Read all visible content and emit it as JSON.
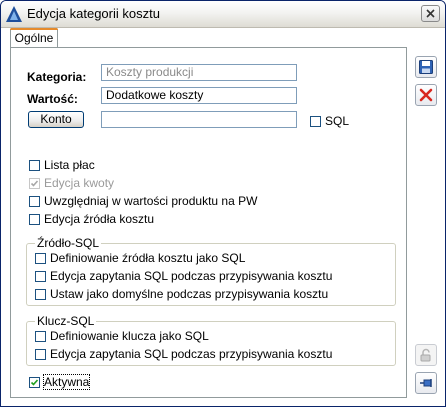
{
  "window": {
    "title": "Edycja kategorii kosztu"
  },
  "tabs": [
    {
      "label": "Ogólne"
    }
  ],
  "form": {
    "kategoria_label": "Kategoria:",
    "kategoria_value": "Koszty produkcji",
    "wartosc_label": "Wartość:",
    "wartosc_value": "Dodatkowe koszty",
    "konto_button": "Konto",
    "konto_value": "",
    "sql_label": "SQL"
  },
  "options": [
    {
      "label": "Lista płac",
      "checked": false,
      "disabled": false
    },
    {
      "label": "Edycja kwoty",
      "checked": true,
      "disabled": true
    },
    {
      "label": "Uwzględniaj w wartości produktu na PW",
      "checked": false,
      "disabled": false
    },
    {
      "label": "Edycja źródła kosztu",
      "checked": false,
      "disabled": false
    }
  ],
  "zrodlo_sql": {
    "title": "Źródło-SQL",
    "items": [
      {
        "label": "Definiowanie źródła kosztu jako SQL",
        "checked": false
      },
      {
        "label": "Edycja zapytania SQL podczas przypisywania kosztu",
        "checked": false
      },
      {
        "label": "Ustaw jako domyślne podczas przypisywania kosztu",
        "checked": false
      }
    ]
  },
  "klucz_sql": {
    "title": "Klucz-SQL",
    "items": [
      {
        "label": "Definiowanie klucza jako SQL",
        "checked": false
      },
      {
        "label": "Edycja zapytania SQL podczas przypisywania kosztu",
        "checked": false
      }
    ]
  },
  "aktywna": {
    "label": "Aktywna",
    "checked": true
  },
  "icons": {
    "app": "app-logo-icon",
    "close": "close-icon",
    "save": "save-icon",
    "cancel": "cancel-icon",
    "lock": "lock-icon",
    "pin": "pin-icon"
  },
  "colors": {
    "title_border": "#0a246a",
    "tab_accent": "#e68b2c",
    "cancel_red": "#d8271f",
    "save_blue": "#2f63b5"
  }
}
